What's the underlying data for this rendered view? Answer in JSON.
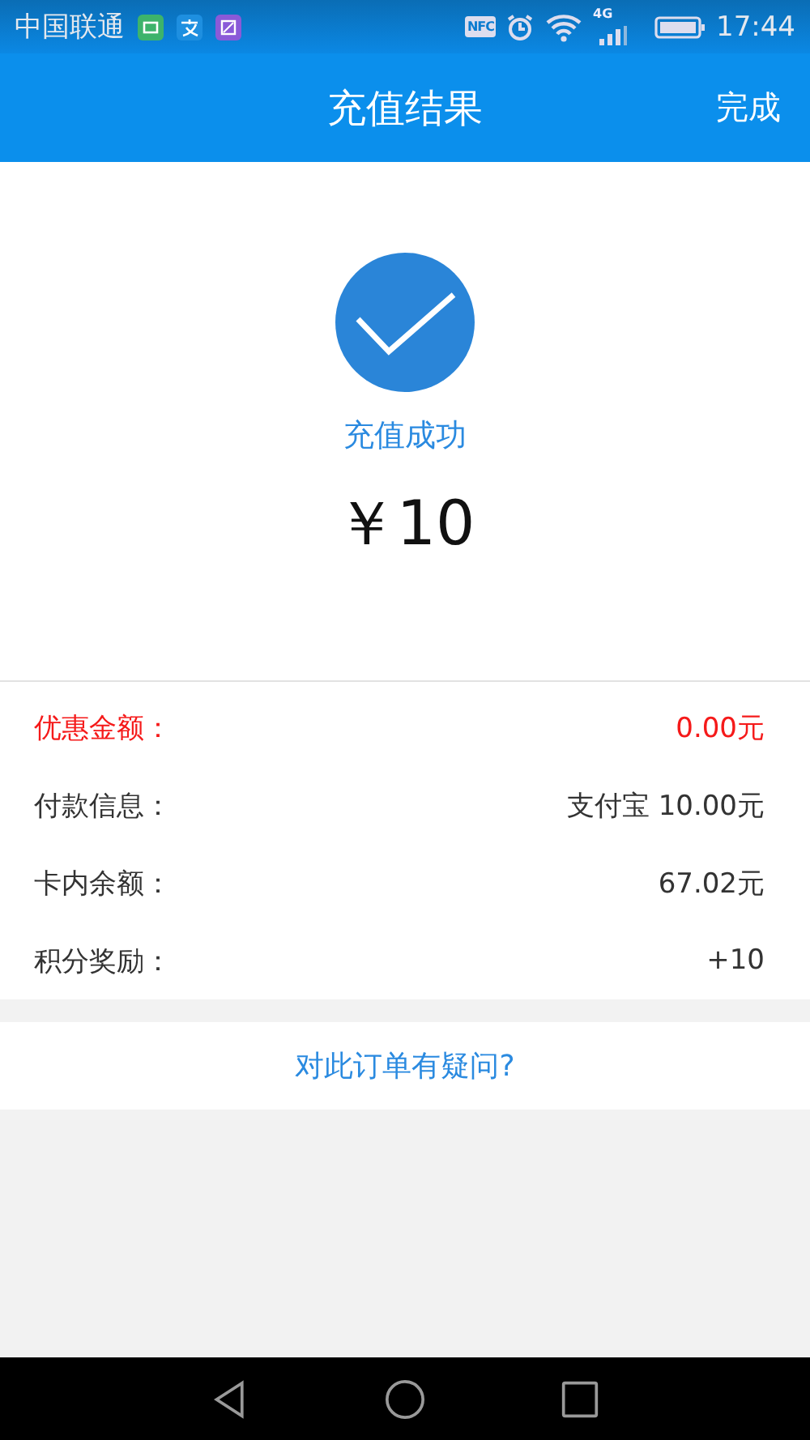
{
  "status_bar": {
    "carrier": "中国联通",
    "nfc": "NFC",
    "network": "4G",
    "time": "17:44"
  },
  "header": {
    "title": "充值结果",
    "action": "完成"
  },
  "result": {
    "status": "充值成功",
    "amount": "￥10"
  },
  "details": [
    {
      "label": "优惠金额：",
      "value": "0.00元",
      "highlight": true
    },
    {
      "label": "付款信息：",
      "value": "支付宝 10.00元",
      "highlight": false
    },
    {
      "label": "卡内余额：",
      "value": "67.02元",
      "highlight": false
    },
    {
      "label": "积分奖励：",
      "value": "+10",
      "highlight": false
    }
  ],
  "help_link": "对此订单有疑问?"
}
